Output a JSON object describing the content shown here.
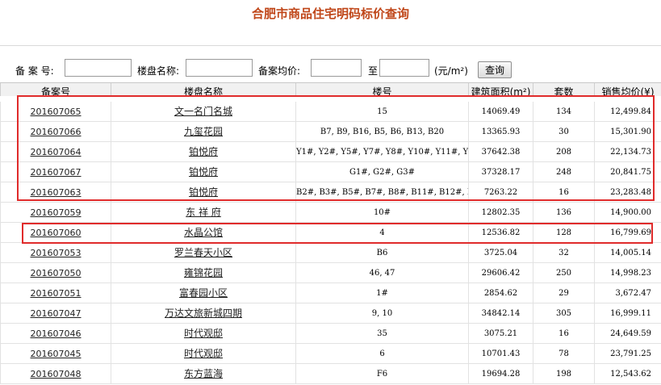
{
  "page_title": "合肥市商品住宅明码标价查询",
  "search": {
    "record_no_label": "备 案 号:",
    "project_name_label": "楼盘名称:",
    "avg_price_label": "备案均价:",
    "to_label": "至",
    "unit_label": "(元/m²)",
    "query_button": "查询",
    "record_no_value": "",
    "project_name_value": "",
    "price_min_value": "",
    "price_max_value": ""
  },
  "table": {
    "headers": [
      "备案号",
      "楼盘名称",
      "楼号",
      "建筑面积(m²)",
      "套数",
      "销售均价(¥)"
    ],
    "rows": [
      [
        "201607065",
        "文一名门名城",
        "15",
        "14069.49",
        "134",
        "12,499.84"
      ],
      [
        "201607066",
        "九玺花园",
        "B7, B9, B16, B5, B6, B13, B20",
        "13365.93",
        "30",
        "15,301.90"
      ],
      [
        "201607064",
        "铂悦府",
        "Y1#, Y2#, Y5#, Y7#, Y8#, Y10#, Y11#, Y9#",
        "37642.38",
        "208",
        "22,134.73"
      ],
      [
        "201607067",
        "铂悦府",
        "G1#, G2#, G3#",
        "37328.17",
        "248",
        "20,841.75"
      ],
      [
        "201607063",
        "铂悦府",
        "B2#, B3#, B5#, B7#, B8#, B11#, B12#, B15#",
        "7263.22",
        "16",
        "23,283.48"
      ],
      [
        "201607059",
        "东 祥 府",
        "10#",
        "12802.35",
        "136",
        "14,900.00"
      ],
      [
        "201607060",
        "水晶公馆",
        "4",
        "12536.82",
        "128",
        "16,799.69"
      ],
      [
        "201607053",
        "罗兰春天小区",
        "B6",
        "3725.04",
        "32",
        "14,005.14"
      ],
      [
        "201607050",
        "雍锦花园",
        "46, 47",
        "29606.42",
        "250",
        "14,998.23"
      ],
      [
        "201607051",
        "富春园小区",
        "1#",
        "2854.62",
        "29",
        "3,672.47"
      ],
      [
        "201607047",
        "万达文旅新城四期",
        "9, 10",
        "34842.14",
        "305",
        "16,999.11"
      ],
      [
        "201607046",
        "时代观邸",
        "35",
        "3075.21",
        "16",
        "24,649.59"
      ],
      [
        "201607045",
        "时代观邸",
        "6",
        "10701.43",
        "78",
        "23,791.25"
      ],
      [
        "201607048",
        "东方蓝海",
        "F6",
        "19694.28",
        "198",
        "12,543.62"
      ]
    ]
  },
  "colors": {
    "title": "#c0471a",
    "highlight_box": "#e02b2b",
    "header_bg": "#f1f1f1"
  }
}
